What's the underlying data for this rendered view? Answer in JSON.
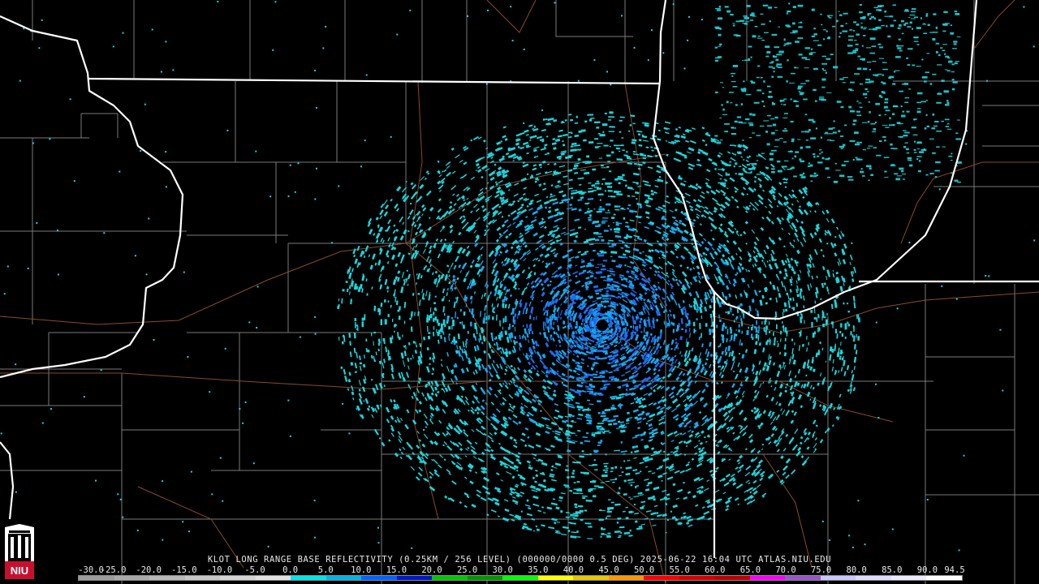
{
  "caption": "KLOT LONG RANGE BASE REFLECTIVITY (0.25KM / 256 LEVEL) (000000/0000 0.5 DEG) 2025-06-22 16:04 UTC  ATLAS.NIU.EDU",
  "logo_text": "NIU",
  "scale": {
    "labels": [
      "-30.0",
      "-25.0",
      "-20.0",
      "-15.0",
      "-10.0",
      "-5.0",
      "0.0",
      "5.0",
      "10.0",
      "15.0",
      "20.0",
      "25.0",
      "30.0",
      "35.0",
      "40.0",
      "45.0",
      "50.0",
      "55.0",
      "60.0",
      "65.0",
      "70.0",
      "75.0",
      "80.0",
      "85.0",
      "90.0",
      "94.5"
    ],
    "colors": [
      "#9b9b9b",
      "#a9a9a9",
      "#b8b8b8",
      "#c6c6c6",
      "#d4d4d4",
      "#e1e1e1",
      "#00e5e5",
      "#00b4e6",
      "#0064ff",
      "#0018c8",
      "#00c800",
      "#009600",
      "#00ff00",
      "#ffff00",
      "#e6c800",
      "#ff9600",
      "#ff0000",
      "#d70000",
      "#c00000",
      "#ff00ff",
      "#9955c9",
      "#c8c8ff",
      "#dcdcff",
      "#ebebff",
      "#ffffff"
    ]
  },
  "colors": {
    "background": "#000000",
    "state_borders": "#ffffff",
    "county_borders": "#7a7a7a",
    "highways": "#8a4a2a",
    "echo_light": "#19d6dc",
    "echo_mid": "#16a8f0",
    "echo_strong": "#1d6cf0"
  }
}
